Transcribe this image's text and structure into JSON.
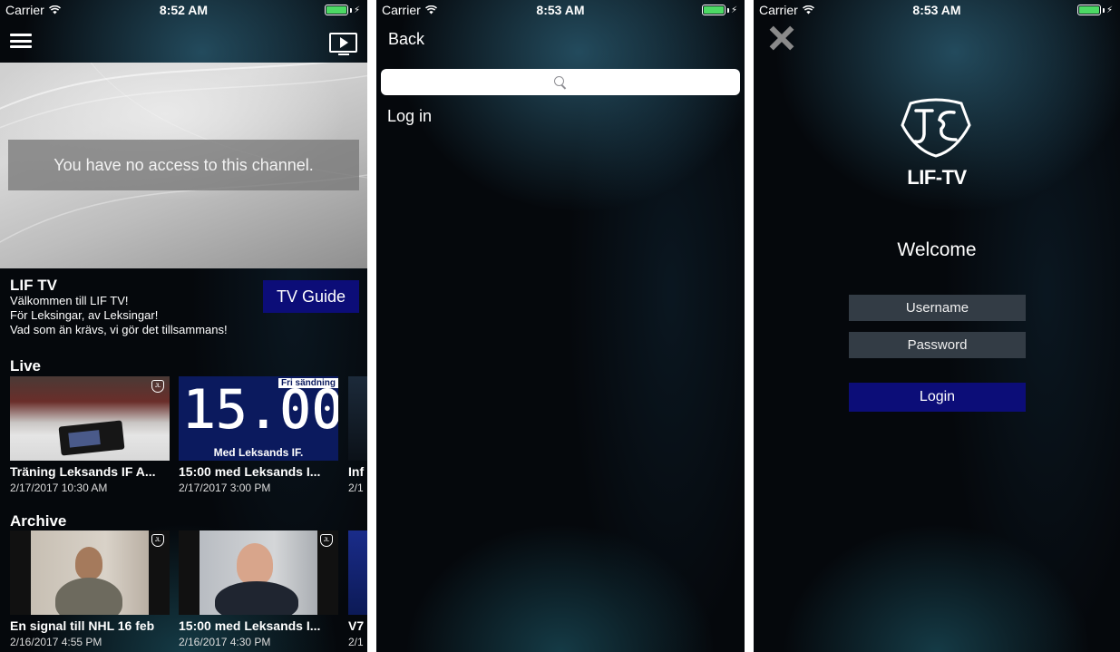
{
  "status_bars": [
    {
      "carrier": "Carrier",
      "time": "8:52 AM"
    },
    {
      "carrier": "Carrier",
      "time": "8:53 AM"
    },
    {
      "carrier": "Carrier",
      "time": "8:53 AM"
    }
  ],
  "colors": {
    "accent_button": "#0c0d78",
    "input_bg": "#333c45",
    "battery": "#4cd964",
    "background": "#05080c"
  },
  "home": {
    "menu_icon": "hamburger-icon",
    "cast_icon": "tv-play-icon",
    "player_message": "You have no access to this channel.",
    "channel": {
      "title": "LIF TV",
      "description_lines": [
        "Välkommen till LIF TV!",
        "För Leksingar, av Leksingar!",
        "Vad som än krävs, vi gör det tillsammans!"
      ],
      "tv_guide_label": "TV Guide"
    },
    "live": {
      "section_title": "Live",
      "items": [
        {
          "title": "Träning Leksands IF A...",
          "date": "2/17/2017 10:30 AM"
        },
        {
          "title": "15:00 med Leksands I...",
          "date": "2/17/2017 3:00 PM",
          "thumb_big": "15.00",
          "thumb_tag": "Fri sändning",
          "thumb_caption": "Med Leksands IF."
        },
        {
          "title": "Inf",
          "date": "2/1"
        }
      ]
    },
    "archive": {
      "section_title": "Archive",
      "items": [
        {
          "title": "En signal till NHL 16 feb",
          "date": "2/16/2017 4:55 PM"
        },
        {
          "title": "15:00 med Leksands I...",
          "date": "2/16/2017 4:30 PM"
        },
        {
          "title": "V7",
          "date": "2/1"
        }
      ]
    }
  },
  "menu": {
    "back_label": "Back",
    "search_placeholder": "",
    "items": [
      "Log in"
    ]
  },
  "login": {
    "logo_text": "LIF-TV",
    "welcome": "Welcome",
    "username_placeholder": "Username",
    "password_placeholder": "Password",
    "login_label": "Login"
  }
}
